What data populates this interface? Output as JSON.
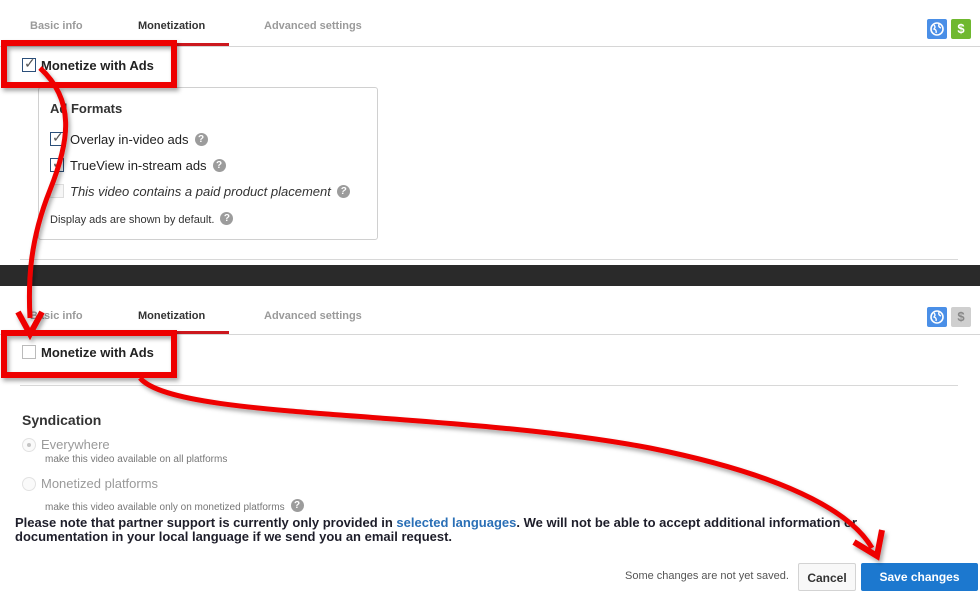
{
  "top_panel": {
    "tabs": [
      {
        "label": "Basic info",
        "active": false
      },
      {
        "label": "Monetization",
        "active": true
      },
      {
        "label": "Advanced settings",
        "active": false
      }
    ],
    "icons": {
      "globe": "globe-icon",
      "dollar": "$"
    },
    "monetize": {
      "label": "Monetize with Ads",
      "checked": true
    },
    "ad_formats": {
      "title": "Ad Formats",
      "items": [
        {
          "label": "Overlay in-video ads",
          "checked": true
        },
        {
          "label": "TrueView in-stream ads",
          "checked": true
        },
        {
          "label": "This video contains a paid product placement",
          "checked": false,
          "disabled": true
        }
      ],
      "note": "Display ads are shown by default."
    },
    "help_glyph": "?"
  },
  "bottom_panel": {
    "tabs": [
      {
        "label": "Basic info",
        "active": false
      },
      {
        "label": "Monetization",
        "active": true
      },
      {
        "label": "Advanced settings",
        "active": false
      }
    ],
    "icons": {
      "globe": "globe-icon",
      "dollar": "$"
    },
    "monetize": {
      "label": "Monetize with Ads",
      "checked": false
    },
    "syndication": {
      "title": "Syndication",
      "options": [
        {
          "label": "Everywhere",
          "sub": "make this video available on all platforms",
          "selected": true
        },
        {
          "label": "Monetized platforms",
          "sub": "make this video available only on monetized platforms",
          "selected": false
        }
      ]
    },
    "note": {
      "before": "Please note that partner support is currently only provided in ",
      "link": "selected languages",
      "after": ". We will not be able to accept additional information or documentation in your local language if we send you an email request."
    },
    "footer": {
      "unsaved": "Some changes are not yet saved.",
      "cancel": "Cancel",
      "save": "Save changes"
    }
  },
  "colors": {
    "accent_red": "#cc181e",
    "annotation_red": "#ee0000",
    "save_blue": "#1c78cf",
    "globe_blue": "#4a8fe7",
    "dollar_green": "#6fb82f",
    "link_blue": "#2a6fb6"
  }
}
